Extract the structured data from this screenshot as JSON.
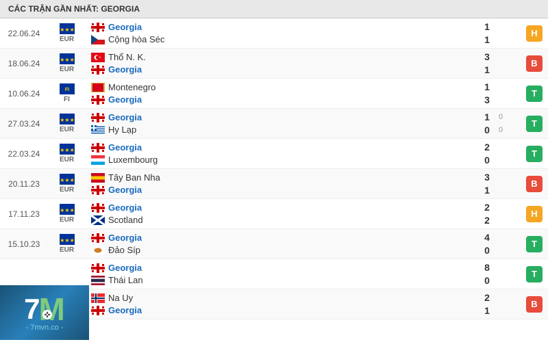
{
  "header": {
    "title": "CÁC TRẬN GẦN NHẤT: GEORGIA"
  },
  "colors": {
    "badge_h": "#f5a623",
    "badge_b": "#e74c3c",
    "badge_t": "#27ae60"
  },
  "logo": {
    "text": "7M",
    "domain": "- 7mvn.co -"
  },
  "matches": [
    {
      "date": "22.06.24",
      "competition_flag": "eu",
      "competition": "EUR",
      "team1": "Georgia",
      "team1_flag": "georgia",
      "team1_is_georgia": true,
      "team2": "Cộng hòa Séc",
      "team2_flag": "czech",
      "team2_is_georgia": false,
      "score1": "1",
      "score2": "1",
      "score1_extra": "",
      "score2_extra": "",
      "result": "H",
      "result_class": "badge-h"
    },
    {
      "date": "18.06.24",
      "competition_flag": "eu",
      "competition": "EUR",
      "team1": "Thổ N. K.",
      "team1_flag": "turkey",
      "team1_is_georgia": false,
      "team2": "Georgia",
      "team2_flag": "georgia",
      "team2_is_georgia": true,
      "score1": "3",
      "score2": "1",
      "score1_extra": "",
      "score2_extra": "",
      "result": "B",
      "result_class": "badge-b"
    },
    {
      "date": "10.06.24",
      "competition_flag": "fi",
      "competition": "FI",
      "team1": "Montenegro",
      "team1_flag": "montenegro",
      "team1_is_georgia": false,
      "team2": "Georgia",
      "team2_flag": "georgia",
      "team2_is_georgia": true,
      "score1": "1",
      "score2": "3",
      "score1_extra": "",
      "score2_extra": "",
      "result": "T",
      "result_class": "badge-t"
    },
    {
      "date": "27.03.24",
      "competition_flag": "eu",
      "competition": "EUR",
      "team1": "Georgia",
      "team1_flag": "georgia",
      "team1_is_georgia": true,
      "team2": "Hy Lạp",
      "team2_flag": "greece",
      "team2_is_georgia": false,
      "score1": "1",
      "score2": "0",
      "score1_extra": "0",
      "score2_extra": "0",
      "result": "T",
      "result_class": "badge-t"
    },
    {
      "date": "22.03.24",
      "competition_flag": "eu",
      "competition": "EUR",
      "team1": "Georgia",
      "team1_flag": "georgia",
      "team1_is_georgia": true,
      "team2": "Luxembourg",
      "team2_flag": "luxembourg",
      "team2_is_georgia": false,
      "score1": "2",
      "score2": "0",
      "score1_extra": "",
      "score2_extra": "",
      "result": "T",
      "result_class": "badge-t"
    },
    {
      "date": "20.11.23",
      "competition_flag": "eu",
      "competition": "EUR",
      "team1": "Tây Ban Nha",
      "team1_flag": "spain",
      "team1_is_georgia": false,
      "team2": "Georgia",
      "team2_flag": "georgia",
      "team2_is_georgia": true,
      "score1": "3",
      "score2": "1",
      "score1_extra": "",
      "score2_extra": "",
      "result": "B",
      "result_class": "badge-b"
    },
    {
      "date": "17.11.23",
      "competition_flag": "eu",
      "competition": "EUR",
      "team1": "Georgia",
      "team1_flag": "georgia",
      "team1_is_georgia": true,
      "team2": "Scotland",
      "team2_flag": "scotland",
      "team2_is_georgia": false,
      "score1": "2",
      "score2": "2",
      "score1_extra": "",
      "score2_extra": "",
      "result": "H",
      "result_class": "badge-h"
    },
    {
      "date": "15.10.23",
      "competition_flag": "eu",
      "competition": "EUR",
      "team1": "Georgia",
      "team1_flag": "georgia",
      "team1_is_georgia": true,
      "team2": "Đảo Síp",
      "team2_flag": "cyprus",
      "team2_is_georgia": false,
      "score1": "4",
      "score2": "0",
      "score1_extra": "",
      "score2_extra": "",
      "result": "T",
      "result_class": "badge-t"
    },
    {
      "date": "",
      "competition_flag": "",
      "competition": "",
      "team1": "Georgia",
      "team1_flag": "georgia",
      "team1_is_georgia": true,
      "team2": "Thái Lan",
      "team2_flag": "thailand",
      "team2_is_georgia": false,
      "score1": "8",
      "score2": "0",
      "score1_extra": "",
      "score2_extra": "",
      "result": "T",
      "result_class": "badge-t"
    },
    {
      "date": "",
      "competition_flag": "",
      "competition": "",
      "team1": "Na Uy",
      "team1_flag": "norway",
      "team1_is_georgia": false,
      "team2": "Georgia",
      "team2_flag": "georgia",
      "team2_is_georgia": true,
      "score1": "2",
      "score2": "1",
      "score1_extra": "",
      "score2_extra": "",
      "result": "B",
      "result_class": "badge-b"
    }
  ]
}
